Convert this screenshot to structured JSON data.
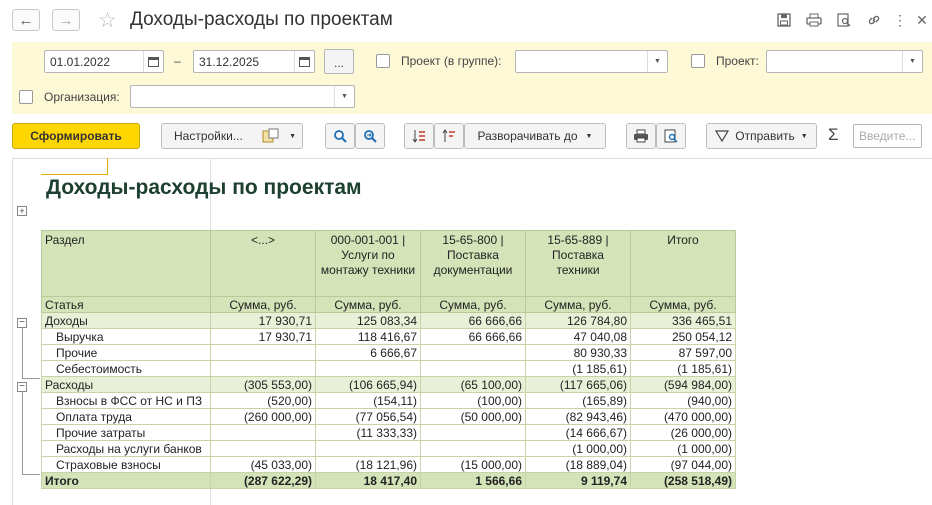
{
  "window": {
    "title": "Доходы-расходы по проектам"
  },
  "filters": {
    "date_from": "01.01.2022",
    "date_sep": "–",
    "date_to": "31.12.2025",
    "more_label": "...",
    "project_group_label": "Проект (в группе):",
    "project_label": "Проект:",
    "organization_label": "Организация:"
  },
  "toolbar": {
    "generate": "Сформировать",
    "settings": "Настройки...",
    "expand_to": "Разворачивать до",
    "send": "Отправить",
    "search_placeholder": "Введите..."
  },
  "report": {
    "title": "Доходы-расходы по проектам",
    "header": {
      "row_label": "Раздел",
      "row_label2": "Статья",
      "columns": [
        "<...>",
        "000-001-001 | Услуги по монтажу техники",
        "15-65-800 | Поставка документации",
        "15-65-889 | Поставка техники",
        "Итого"
      ],
      "measure": "Сумма, руб."
    },
    "rows": [
      {
        "label": "Доходы",
        "type": "group",
        "values": [
          "17 930,71",
          "125 083,34",
          "66 666,66",
          "126 784,80",
          "336 465,51"
        ]
      },
      {
        "label": "Выручка",
        "type": "item",
        "values": [
          "17 930,71",
          "118 416,67",
          "66 666,66",
          "47 040,08",
          "250 054,12"
        ]
      },
      {
        "label": "Прочие",
        "type": "item",
        "values": [
          "",
          "6 666,67",
          "",
          "80 930,33",
          "87 597,00"
        ]
      },
      {
        "label": "Себестоимость",
        "type": "item",
        "values": [
          "",
          "",
          "",
          "(1 185,61)",
          "(1 185,61)"
        ]
      },
      {
        "label": "Расходы",
        "type": "group",
        "values": [
          "(305 553,00)",
          "(106 665,94)",
          "(65 100,00)",
          "(117 665,06)",
          "(594 984,00)"
        ]
      },
      {
        "label": "Взносы в ФСС от НС и ПЗ",
        "type": "item",
        "values": [
          "(520,00)",
          "(154,11)",
          "(100,00)",
          "(165,89)",
          "(940,00)"
        ]
      },
      {
        "label": "Оплата труда",
        "type": "item",
        "values": [
          "(260 000,00)",
          "(77 056,54)",
          "(50 000,00)",
          "(82 943,46)",
          "(470 000,00)"
        ]
      },
      {
        "label": "Прочие затраты",
        "type": "item",
        "values": [
          "",
          "(11 333,33)",
          "",
          "(14 666,67)",
          "(26 000,00)"
        ]
      },
      {
        "label": "Расходы на услуги банков",
        "type": "item",
        "values": [
          "",
          "",
          "",
          "(1 000,00)",
          "(1 000,00)"
        ]
      },
      {
        "label": "Страховые взносы",
        "type": "item",
        "values": [
          "(45 033,00)",
          "(18 121,96)",
          "(15 000,00)",
          "(18 889,04)",
          "(97 044,00)"
        ]
      },
      {
        "label": "Итого",
        "type": "total",
        "values": [
          "(287 622,29)",
          "18 417,40",
          "1 566,66",
          "9 119,74",
          "(258 518,49)"
        ]
      }
    ]
  }
}
